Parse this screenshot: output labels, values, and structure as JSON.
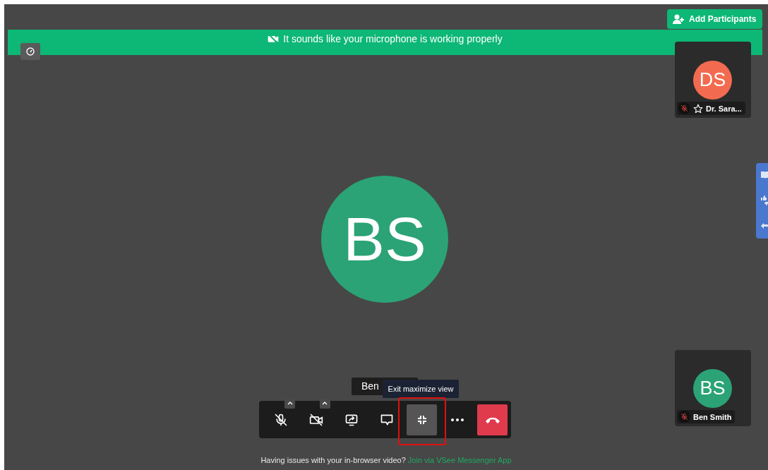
{
  "banner": {
    "text": "It sounds like your microphone is working properly"
  },
  "add_participants": {
    "label": "Add Participants"
  },
  "main_participant": {
    "initials": "BS",
    "color": "#2ba376"
  },
  "participants": [
    {
      "initials": "DS",
      "name": "Dr. Sara...",
      "color": "#f26b50",
      "muted": true,
      "starred": true
    },
    {
      "initials": "BS",
      "name": "Ben Smith",
      "color": "#2ba376",
      "muted": true,
      "starred": false
    }
  ],
  "name_label": "Ben",
  "tooltip": "Exit maximize view",
  "toolbar": [
    {
      "kind": "mic",
      "muted": true,
      "selected": false
    },
    {
      "kind": "camera",
      "muted": true,
      "selected": false
    },
    {
      "kind": "share",
      "selected": false
    },
    {
      "kind": "chat",
      "selected": false
    },
    {
      "kind": "minimize",
      "selected": true
    },
    {
      "kind": "more",
      "selected": false
    },
    {
      "kind": "hangup",
      "selected": false
    }
  ],
  "help": {
    "text": "Having issues with your in-browser video?",
    "link": "Join via VSee Messenger App"
  }
}
